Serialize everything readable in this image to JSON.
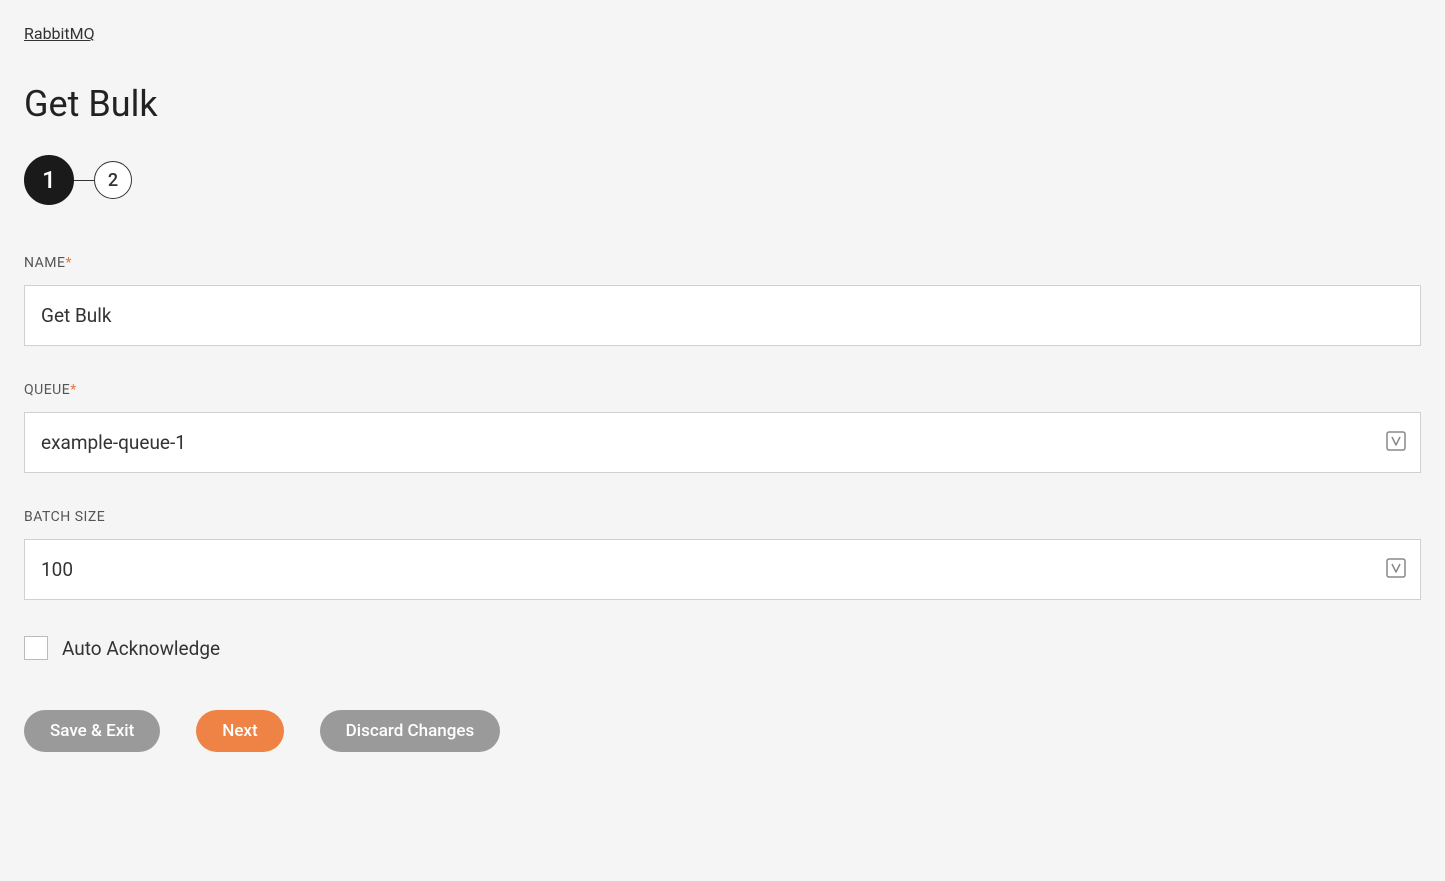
{
  "breadcrumb": "RabbitMQ",
  "page_title": "Get Bulk",
  "stepper": {
    "step1": "1",
    "step2": "2"
  },
  "form": {
    "name_label": "NAME",
    "name_value": "Get Bulk",
    "queue_label": "QUEUE",
    "queue_value": "example-queue-1",
    "batch_size_label": "BATCH SIZE",
    "batch_size_value": "100",
    "auto_ack_label": "Auto Acknowledge",
    "auto_ack_checked": false
  },
  "buttons": {
    "save_exit": "Save & Exit",
    "next": "Next",
    "discard": "Discard Changes"
  }
}
